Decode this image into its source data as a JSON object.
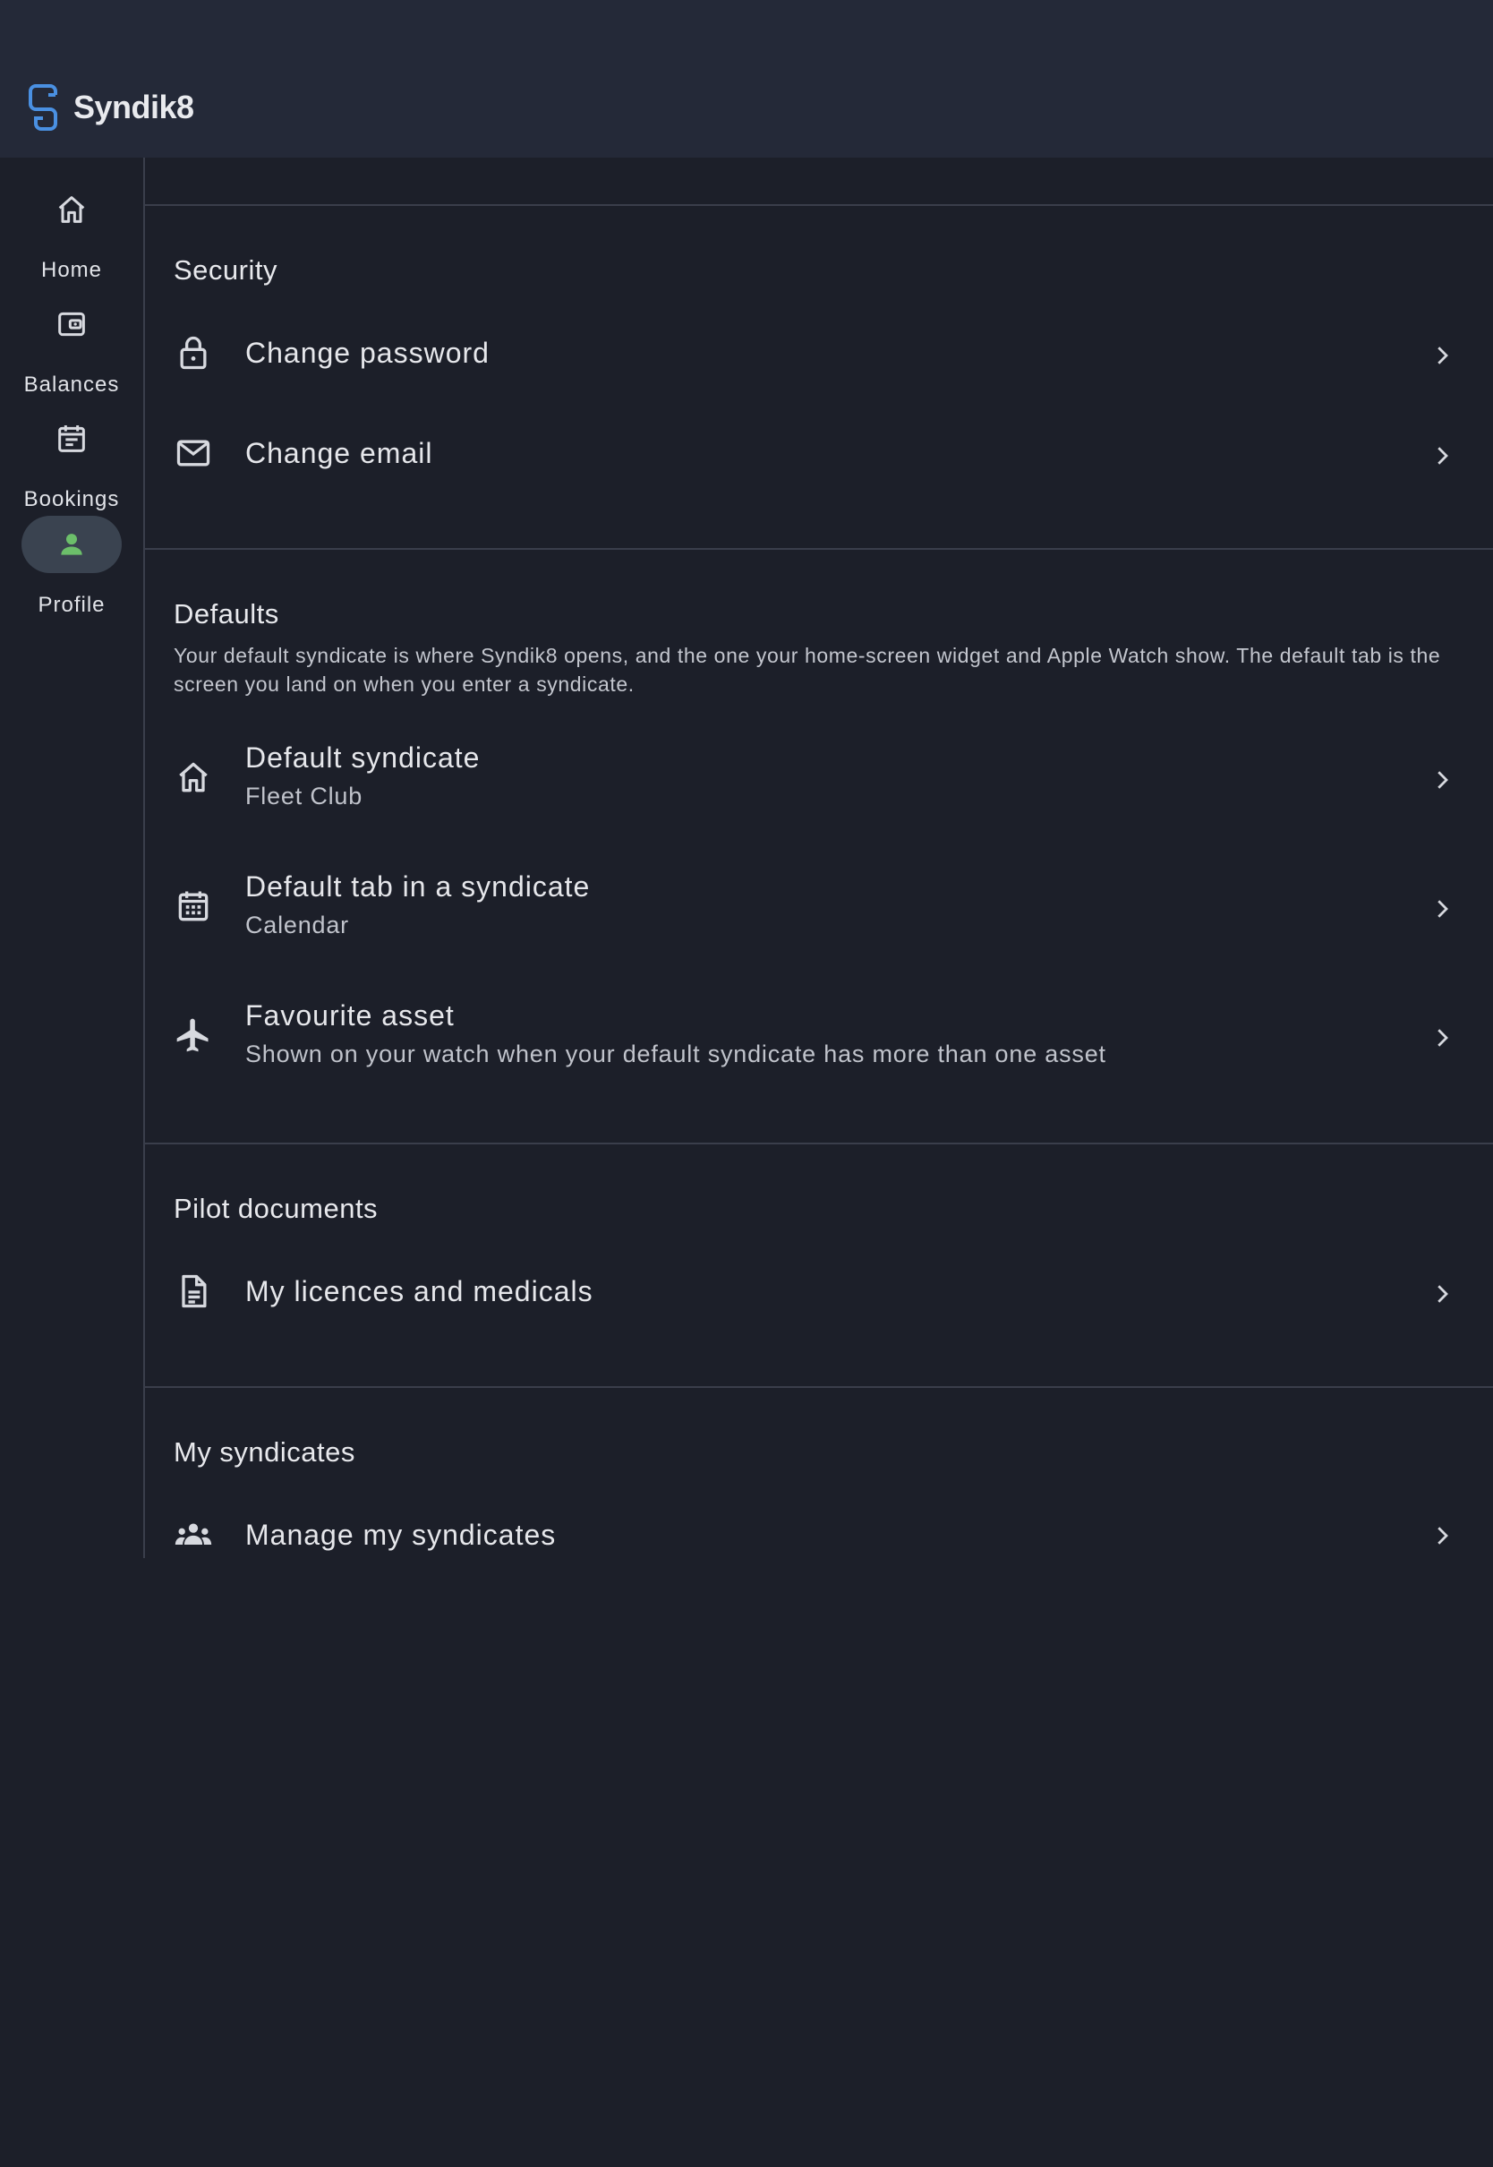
{
  "app": {
    "name": "Syndik8",
    "brand_color": "#4a90e2"
  },
  "nav": [
    {
      "label": "Home",
      "icon": "home-icon",
      "active": false
    },
    {
      "label": "Balances",
      "icon": "wallet-icon",
      "active": false
    },
    {
      "label": "Bookings",
      "icon": "calendar-list-icon",
      "active": false
    },
    {
      "label": "Profile",
      "icon": "person-icon",
      "active": true
    }
  ],
  "colors": {
    "active_icon": "#6cbf6a",
    "active_pill": "#3a4350",
    "background": "#1c1f29",
    "header": "#242938"
  },
  "sections": {
    "security": {
      "title": "Security",
      "items": [
        {
          "title": "Change password",
          "icon": "lock-icon"
        },
        {
          "title": "Change email",
          "icon": "mail-icon"
        }
      ]
    },
    "defaults": {
      "title": "Defaults",
      "description": "Your default syndicate is where Syndik8 opens, and the one your home-screen widget and Apple Watch show. The default tab is the screen you land on when you enter a syndicate.",
      "items": [
        {
          "title": "Default syndicate",
          "subtitle": "Fleet Club",
          "icon": "home-icon"
        },
        {
          "title": "Default tab in a syndicate",
          "subtitle": "Calendar",
          "icon": "calendar-icon"
        },
        {
          "title": "Favourite asset",
          "subtitle": "Shown on your watch when your default syndicate has more than one asset",
          "icon": "airplane-icon"
        }
      ]
    },
    "pilot_documents": {
      "title": "Pilot documents",
      "items": [
        {
          "title": "My licences and medicals",
          "icon": "document-icon"
        }
      ]
    },
    "my_syndicates": {
      "title": "My syndicates",
      "items": [
        {
          "title": "Manage my syndicates",
          "icon": "group-icon"
        }
      ]
    }
  }
}
